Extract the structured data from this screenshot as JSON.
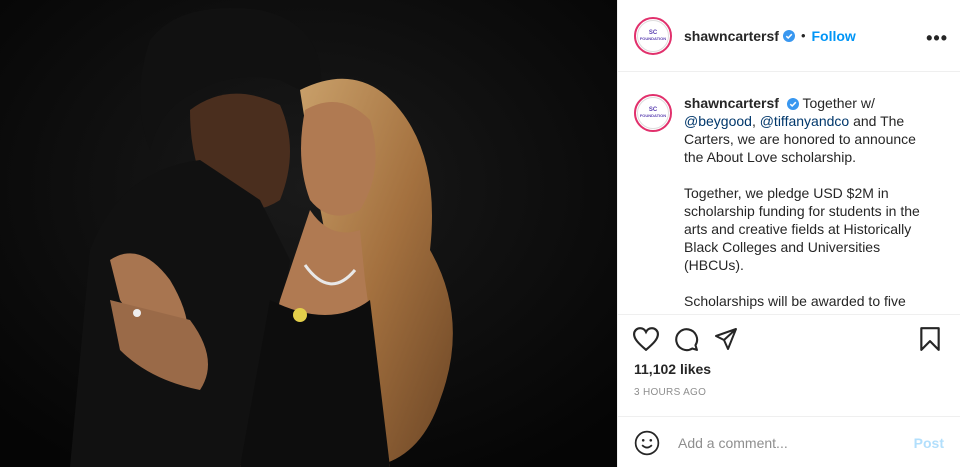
{
  "post": {
    "username": "shawncartersf",
    "follow_label": "Follow",
    "separator": "•",
    "more_label": "•••",
    "avatar_line1": "SC",
    "avatar_line2": "FOUNDATION",
    "caption": {
      "username": "shawncartersf",
      "text_before": "Together w/",
      "mention1": "@beygood",
      "comma": ",",
      "mention2": "@tiffanyandco",
      "text_after": "and The Carters, we are honored to announce the About Love scholarship.",
      "paragraph2": "Together, we pledge USD $2M in scholarship funding for students in the arts and creative fields at Historically Black Colleges and Universities (HBCUs).",
      "paragraph3": "Scholarships will be awarded to five"
    },
    "likes": "11,102 likes",
    "timestamp": "3 HOURS AGO",
    "comment_placeholder": "Add a comment...",
    "post_label": "Post"
  },
  "colors": {
    "accent": "#0095f6",
    "link": "#00376b",
    "avatar_ring": "#e1306c",
    "verified": "#3897f0",
    "post_disabled": "#b2dffc"
  },
  "icons": [
    "verified-badge-icon",
    "heart-icon",
    "comment-icon",
    "share-icon",
    "bookmark-icon",
    "emoji-icon",
    "more-options-icon"
  ]
}
